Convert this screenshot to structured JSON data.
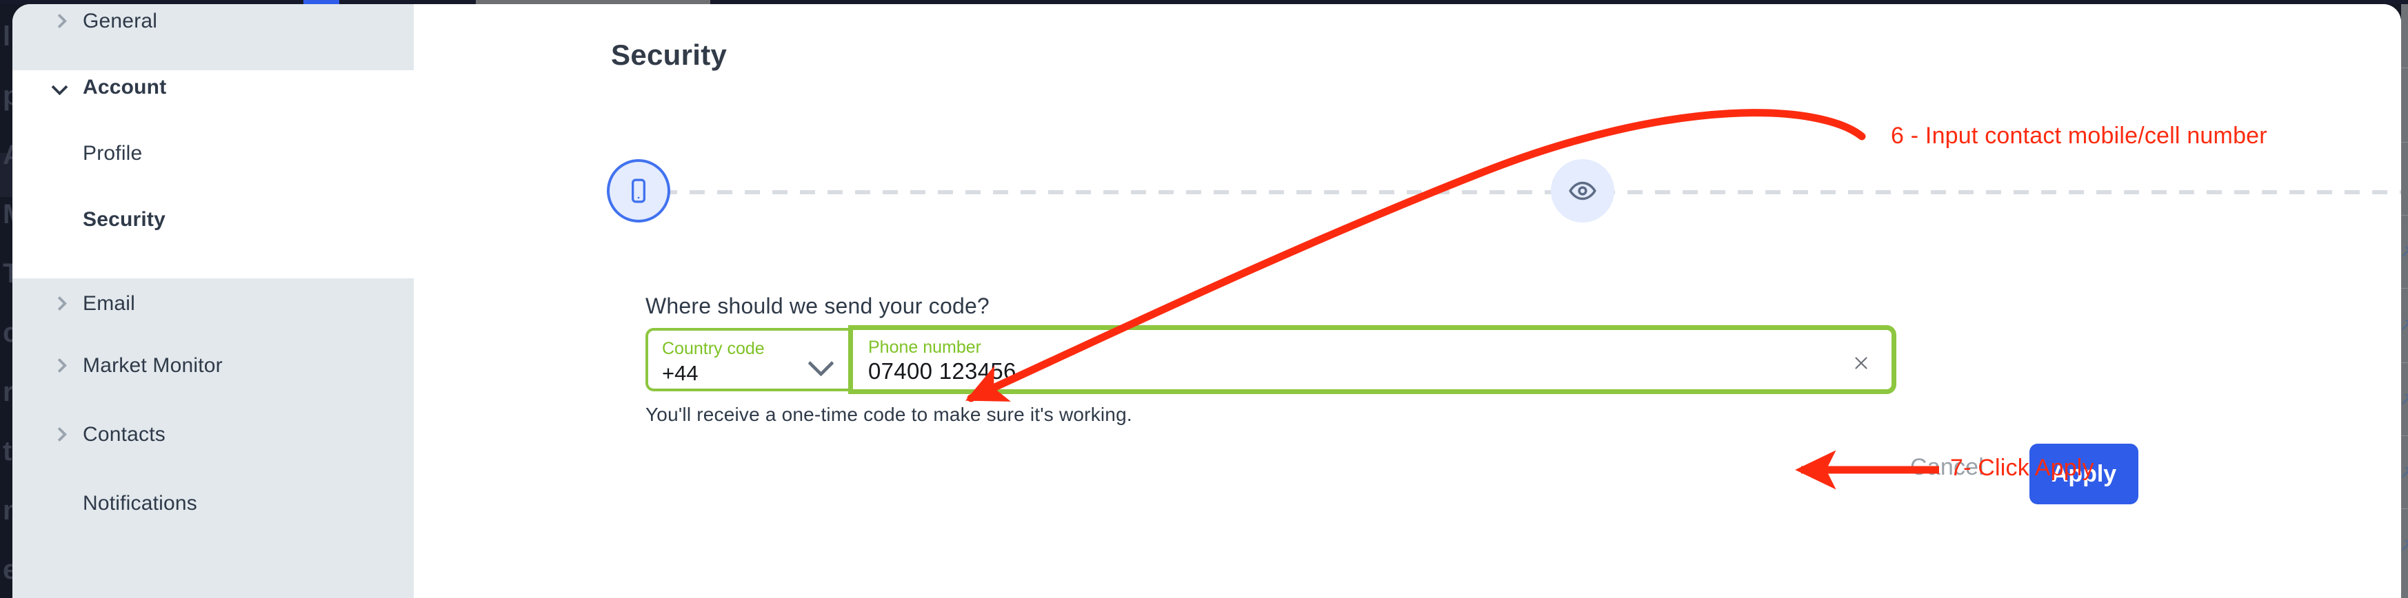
{
  "app": {
    "backdrop_color": "#141824",
    "accent_color": "#2f5ce8",
    "highlight_green": "#8dc63f",
    "annotation_color": "#fc2b10"
  },
  "sidebar": {
    "items": [
      {
        "label": "General",
        "icon": "chevron-right-icon",
        "state": "collapsed",
        "level": 0,
        "selected": false,
        "bold": false
      },
      {
        "label": "Account",
        "icon": "chevron-down-icon",
        "state": "expanded",
        "level": 0,
        "selected": false,
        "bold": true
      },
      {
        "label": "Profile",
        "icon": "none",
        "state": "leaf",
        "level": 1,
        "selected": false,
        "bold": false
      },
      {
        "label": "Security",
        "icon": "none",
        "state": "leaf",
        "level": 1,
        "selected": true,
        "bold": true
      },
      {
        "label": "Email",
        "icon": "chevron-right-icon",
        "state": "collapsed",
        "level": 0,
        "selected": false,
        "bold": false
      },
      {
        "label": "Market Monitor",
        "icon": "chevron-right-icon",
        "state": "collapsed",
        "level": 0,
        "selected": false,
        "bold": false
      },
      {
        "label": "Contacts",
        "icon": "chevron-right-icon",
        "state": "collapsed",
        "level": 0,
        "selected": false,
        "bold": false
      },
      {
        "label": "Notifications",
        "icon": "none",
        "state": "leaf",
        "level": 0,
        "selected": false,
        "bold": false
      }
    ]
  },
  "header": {
    "title": "Security",
    "close_icon": "close-icon"
  },
  "stepper": {
    "steps": [
      {
        "icon": "mobile-phone-icon",
        "active": true
      },
      {
        "icon": "eye-icon",
        "active": false
      },
      {
        "icon": "save-disk-icon",
        "active": false
      }
    ]
  },
  "form": {
    "question": "Where should we send your code?",
    "country_code": {
      "label": "Country code",
      "value": "+44",
      "chevron_icon": "chevron-down-icon"
    },
    "phone_number": {
      "label": "Phone number",
      "value": "07400 123456",
      "placeholder": "Phone number",
      "clear_icon": "close-icon"
    },
    "hint": "You'll receive a one-time code to make sure it's working."
  },
  "actions": {
    "cancel_label": "Cancel",
    "apply_label": "Apply"
  },
  "annotations": [
    {
      "id": "step-6",
      "text": "6 - Input contact mobile/cell number",
      "arrow": "curved-arrow-to-phone-field"
    },
    {
      "id": "step-7",
      "text": "7- Click Apply",
      "arrow": "straight-arrow-to-apply-button"
    }
  ],
  "backdrop_ghost_lines": [
    "l",
    "px",
    "A",
    "M",
    "T",
    "c",
    "r",
    "t",
    "ni",
    "ec"
  ]
}
